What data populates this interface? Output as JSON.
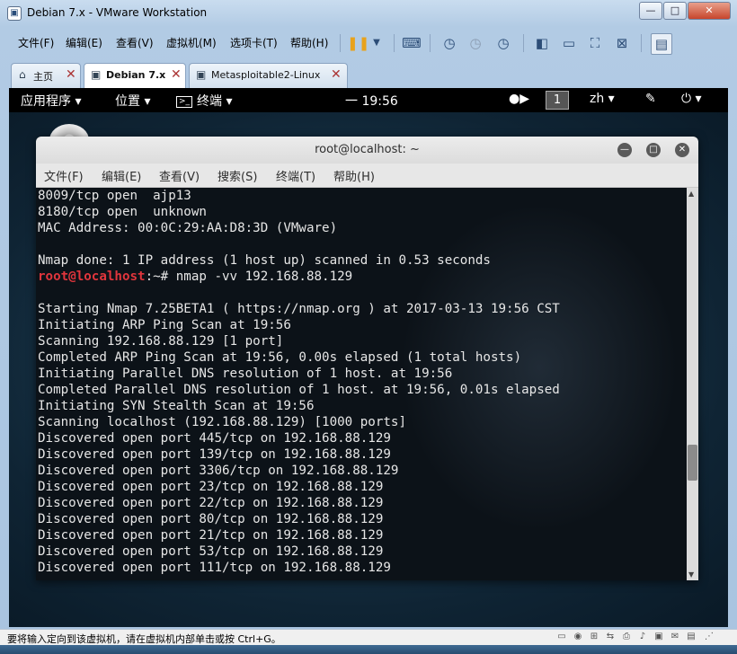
{
  "window": {
    "title": "Debian 7.x - VMware Workstation",
    "min": "—",
    "max": "□",
    "close": "✕"
  },
  "menubar": {
    "items": [
      "文件(F)",
      "编辑(E)",
      "查看(V)",
      "虚拟机(M)",
      "选项卡(T)",
      "帮助(H)"
    ]
  },
  "tabs": [
    {
      "label": "主页",
      "close": "✕"
    },
    {
      "label": "Debian 7.x",
      "close": "✕"
    },
    {
      "label": "Metasploitable2-Linux",
      "close": "✕"
    }
  ],
  "gnome": {
    "apps": "应用程序 ▾",
    "places": "位置 ▾",
    "terminal": "终端 ▾",
    "clock": "一 19:56",
    "workspace": "1",
    "lang": "zh ▾",
    "power": "⏻ ▾"
  },
  "terminal": {
    "title": "root@localhost: ~",
    "menu": [
      "文件(F)",
      "编辑(E)",
      "查看(V)",
      "搜索(S)",
      "终端(T)",
      "帮助(H)"
    ],
    "prompt_user": "root@localhost",
    "lines_before": [
      "8009/tcp open  ajp13",
      "8180/tcp open  unknown",
      "MAC Address: 00:0C:29:AA:D8:3D (VMware)",
      "",
      "Nmap done: 1 IP address (1 host up) scanned in 0.53 seconds"
    ],
    "prompt_cmd": ":~# nmap -vv 192.168.88.129",
    "lines_after": [
      "",
      "Starting Nmap 7.25BETA1 ( https://nmap.org ) at 2017-03-13 19:56 CST",
      "Initiating ARP Ping Scan at 19:56",
      "Scanning 192.168.88.129 [1 port]",
      "Completed ARP Ping Scan at 19:56, 0.00s elapsed (1 total hosts)",
      "Initiating Parallel DNS resolution of 1 host. at 19:56",
      "Completed Parallel DNS resolution of 1 host. at 19:56, 0.01s elapsed",
      "Initiating SYN Stealth Scan at 19:56",
      "Scanning localhost (192.168.88.129) [1000 ports]",
      "Discovered open port 445/tcp on 192.168.88.129",
      "Discovered open port 139/tcp on 192.168.88.129",
      "Discovered open port 3306/tcp on 192.168.88.129",
      "Discovered open port 23/tcp on 192.168.88.129",
      "Discovered open port 22/tcp on 192.168.88.129",
      "Discovered open port 80/tcp on 192.168.88.129",
      "Discovered open port 21/tcp on 192.168.88.129",
      "Discovered open port 53/tcp on 192.168.88.129",
      "Discovered open port 111/tcp on 192.168.88.129"
    ]
  },
  "statusbar": {
    "text": "要将输入定向到该虚拟机，请在虚拟机内部单击或按 Ctrl+G。"
  }
}
